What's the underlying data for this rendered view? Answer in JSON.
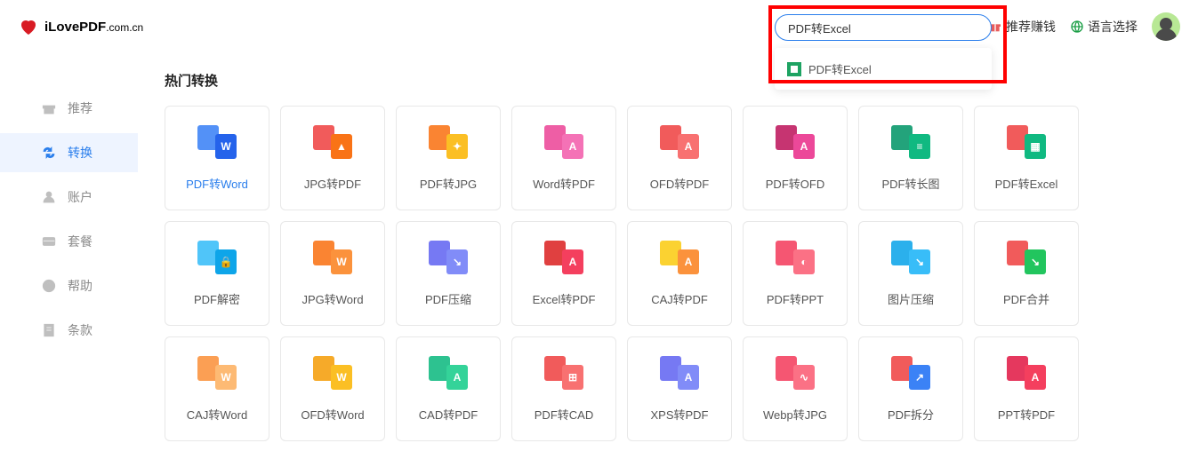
{
  "brand": {
    "name": "iLovePDF",
    "domain": ".com.cn"
  },
  "nav": {
    "recommend": "推荐赚钱",
    "language": "语言选择"
  },
  "search": {
    "value": "PDF转Excel",
    "suggestion": "PDF转Excel"
  },
  "sidebar": [
    {
      "id": "recommend",
      "label": "推荐"
    },
    {
      "id": "convert",
      "label": "转换"
    },
    {
      "id": "account",
      "label": "账户"
    },
    {
      "id": "plan",
      "label": "套餐"
    },
    {
      "id": "help",
      "label": "帮助"
    },
    {
      "id": "terms",
      "label": "条款"
    }
  ],
  "section_title": "热门转换",
  "cards": [
    {
      "id": "pdf-to-word",
      "label": "PDF转Word",
      "back": "#3b82f6",
      "front": "#2563eb",
      "glyph": "W"
    },
    {
      "id": "jpg-to-pdf",
      "label": "JPG转PDF",
      "back": "#ef4444",
      "front": "#f97316",
      "glyph": "▲"
    },
    {
      "id": "pdf-to-jpg",
      "label": "PDF转JPG",
      "back": "#f97316",
      "front": "#fbbf24",
      "glyph": "✦"
    },
    {
      "id": "word-to-pdf",
      "label": "Word转PDF",
      "back": "#ec4899",
      "front": "#f472b6",
      "glyph": "A"
    },
    {
      "id": "ofd-to-pdf",
      "label": "OFD转PDF",
      "back": "#ef4444",
      "front": "#f87171",
      "glyph": "A"
    },
    {
      "id": "pdf-to-ofd",
      "label": "PDF转OFD",
      "back": "#be185d",
      "front": "#ec4899",
      "glyph": "A"
    },
    {
      "id": "pdf-to-longimg",
      "label": "PDF转长图",
      "back": "#059669",
      "front": "#10b981",
      "glyph": "≡"
    },
    {
      "id": "pdf-to-excel",
      "label": "PDF转Excel",
      "back": "#ef4444",
      "front": "#10b981",
      "glyph": "▦"
    },
    {
      "id": "pdf-decrypt",
      "label": "PDF解密",
      "back": "#38bdf8",
      "front": "#0ea5e9",
      "glyph": "🔒"
    },
    {
      "id": "jpg-to-word",
      "label": "JPG转Word",
      "back": "#f97316",
      "front": "#fb923c",
      "glyph": "W"
    },
    {
      "id": "pdf-compress",
      "label": "PDF压缩",
      "back": "#6366f1",
      "front": "#818cf8",
      "glyph": "↘"
    },
    {
      "id": "excel-to-pdf",
      "label": "Excel转PDF",
      "back": "#dc2626",
      "front": "#f43f5e",
      "glyph": "A"
    },
    {
      "id": "caj-to-pdf",
      "label": "CAJ转PDF",
      "back": "#facc15",
      "front": "#fb923c",
      "glyph": "A"
    },
    {
      "id": "pdf-to-ppt",
      "label": "PDF转PPT",
      "back": "#f43f5e",
      "front": "#fb7185",
      "glyph": "◐"
    },
    {
      "id": "img-compress",
      "label": "图片压缩",
      "back": "#0ea5e9",
      "front": "#38bdf8",
      "glyph": "↘"
    },
    {
      "id": "pdf-merge",
      "label": "PDF合并",
      "back": "#ef4444",
      "front": "#22c55e",
      "glyph": "↘"
    },
    {
      "id": "caj-to-word",
      "label": "CAJ转Word",
      "back": "#fb923c",
      "front": "#fdba74",
      "glyph": "W"
    },
    {
      "id": "ofd-to-word",
      "label": "OFD转Word",
      "back": "#f59e0b",
      "front": "#fbbf24",
      "glyph": "W"
    },
    {
      "id": "cad-to-pdf",
      "label": "CAD转PDF",
      "back": "#10b981",
      "front": "#34d399",
      "glyph": "A"
    },
    {
      "id": "pdf-to-cad",
      "label": "PDF转CAD",
      "back": "#ef4444",
      "front": "#f87171",
      "glyph": "⊞"
    },
    {
      "id": "xps-to-pdf",
      "label": "XPS转PDF",
      "back": "#6366f1",
      "front": "#818cf8",
      "glyph": "A"
    },
    {
      "id": "webp-to-jpg",
      "label": "Webp转JPG",
      "back": "#f43f5e",
      "front": "#fb7185",
      "glyph": "∿"
    },
    {
      "id": "pdf-split",
      "label": "PDF拆分",
      "back": "#ef4444",
      "front": "#3b82f6",
      "glyph": "↗"
    },
    {
      "id": "ppt-to-pdf",
      "label": "PPT转PDF",
      "back": "#e11d48",
      "front": "#f43f5e",
      "glyph": "A"
    }
  ]
}
